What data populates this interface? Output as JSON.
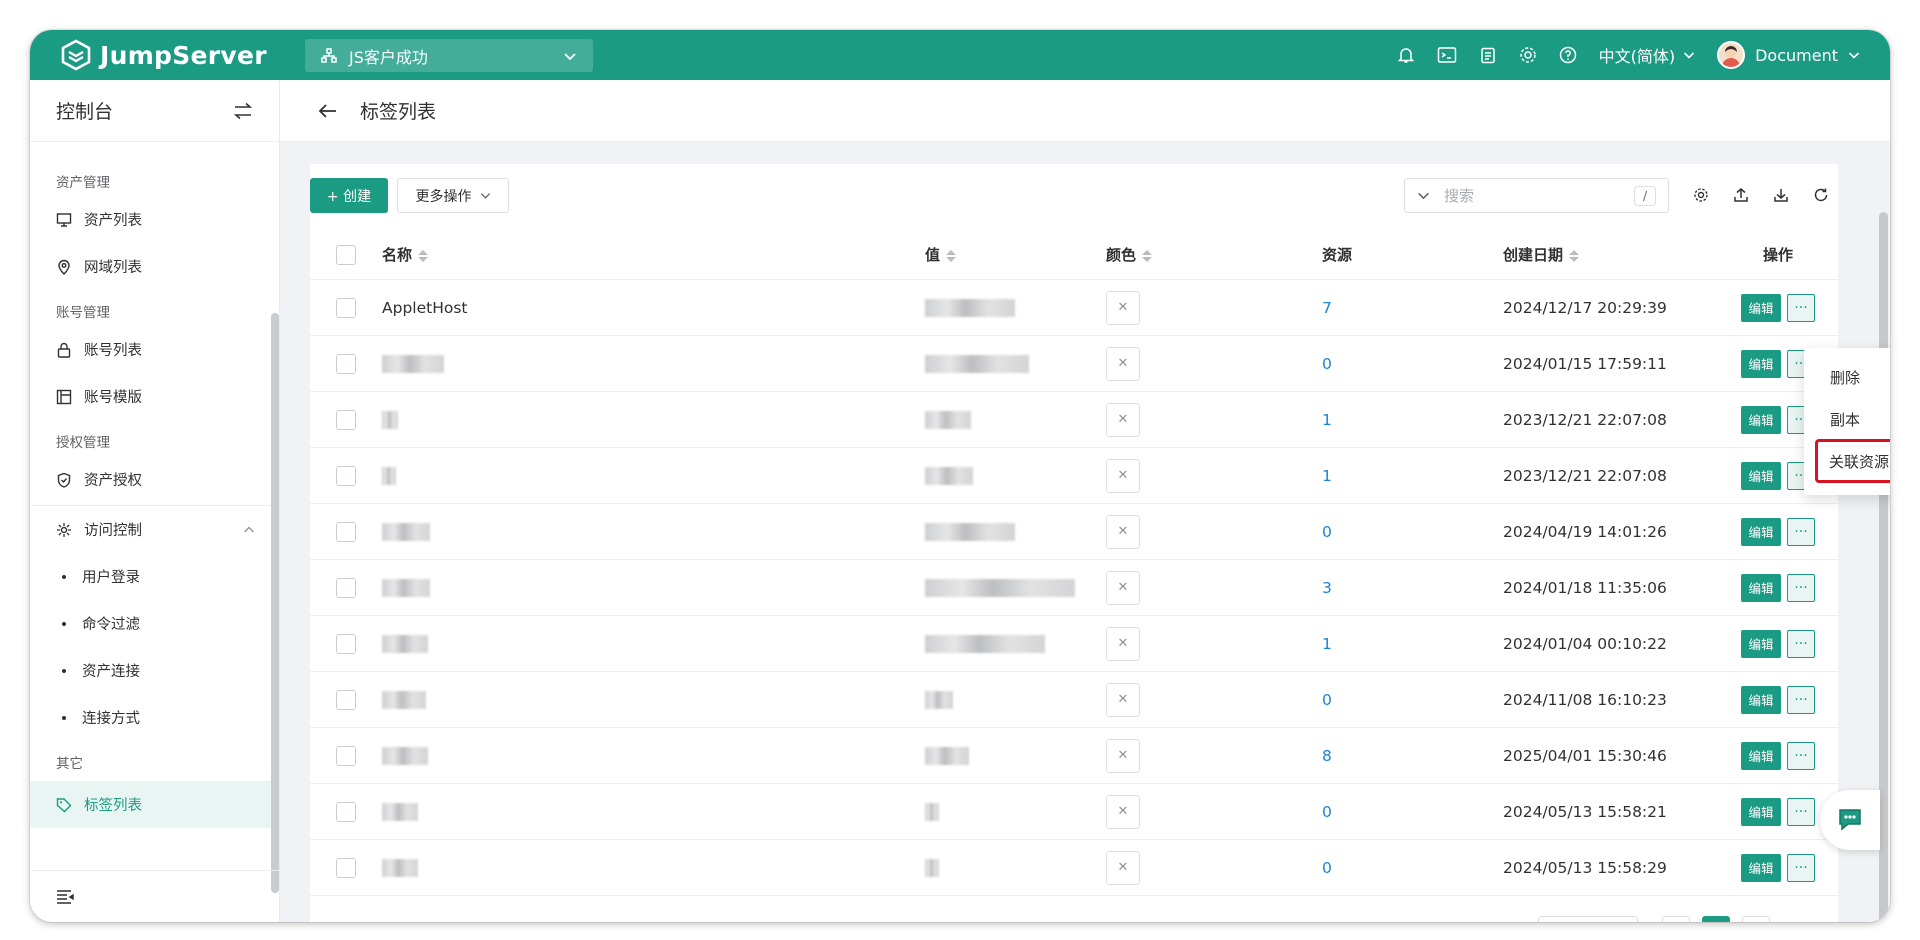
{
  "app": {
    "brand": "JumpServer",
    "org": "JS客户成功",
    "language": "中文(简体)",
    "user": "Document"
  },
  "sidebar": {
    "title": "控制台",
    "groups": [
      {
        "label": "资产管理",
        "items": [
          {
            "label": "资产列表",
            "icon": "monitor-icon"
          },
          {
            "label": "网域列表",
            "icon": "location-icon"
          }
        ]
      },
      {
        "label": "账号管理",
        "items": [
          {
            "label": "账号列表",
            "icon": "lock-icon"
          },
          {
            "label": "账号模版",
            "icon": "template-icon"
          }
        ]
      },
      {
        "label": "授权管理",
        "items": [
          {
            "label": "资产授权",
            "icon": "shield-icon"
          }
        ]
      }
    ],
    "access_control": {
      "label": "访问控制",
      "subitems": [
        "用户登录",
        "命令过滤",
        "资产连接",
        "连接方式"
      ]
    },
    "other_group": "其它",
    "active_item": "标签列表"
  },
  "page": {
    "title": "标签列表",
    "create_label": "+ 创建",
    "more_label": "更多操作",
    "search_placeholder": "搜索",
    "search_shortcut": "/"
  },
  "table": {
    "headers": {
      "name": "名称",
      "value": "值",
      "color": "颜色",
      "resources": "资源",
      "created": "创建日期",
      "actions": "操作"
    },
    "edit_label": "编辑",
    "rows": [
      {
        "name": "AppletHost",
        "resources": "7",
        "created": "2024/12/17 20:29:39"
      },
      {
        "name": "",
        "resources": "0",
        "created": "2024/01/15 17:59:11"
      },
      {
        "name": "",
        "resources": "1",
        "created": "2023/12/21 22:07:08"
      },
      {
        "name": "",
        "resources": "1",
        "created": "2023/12/21 22:07:08"
      },
      {
        "name": "",
        "resources": "0",
        "created": "2024/04/19 14:01:26"
      },
      {
        "name": "",
        "resources": "3",
        "created": "2024/01/18 11:35:06"
      },
      {
        "name": "",
        "resources": "1",
        "created": "2024/01/04 00:10:22"
      },
      {
        "name": "",
        "resources": "0",
        "created": "2024/11/08 16:10:23"
      },
      {
        "name": "",
        "resources": "8",
        "created": "2025/04/01 15:30:46"
      },
      {
        "name": "",
        "resources": "0",
        "created": "2024/05/13 15:58:21"
      },
      {
        "name": "",
        "resources": "0",
        "created": "2024/05/13 15:58:29"
      }
    ]
  },
  "dropdown": {
    "items": [
      "删除",
      "副本",
      "关联资源"
    ],
    "highlighted": "关联资源"
  },
  "colors": {
    "primary": "#1b9b84",
    "link": "#1d83d4",
    "highlight_border": "#d9121f"
  }
}
